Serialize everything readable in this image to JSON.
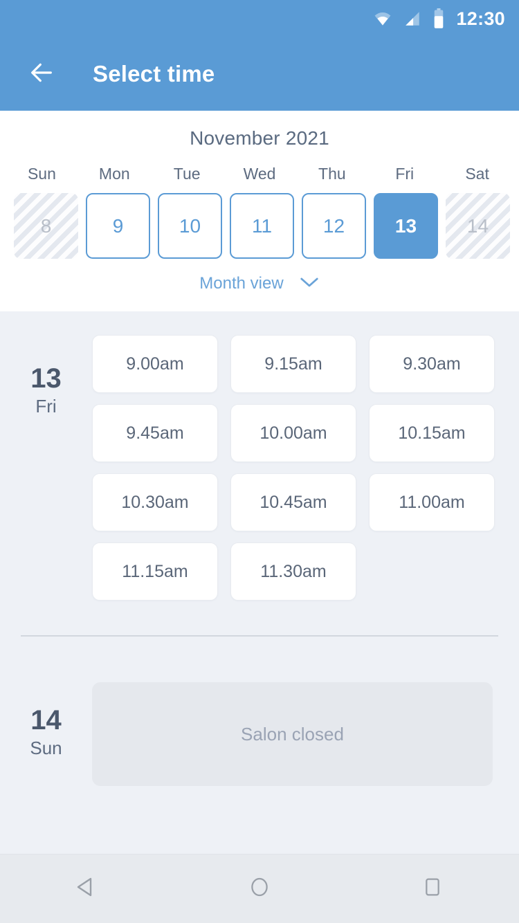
{
  "status_bar": {
    "time": "12:30",
    "icons": [
      "wifi-icon",
      "signal-icon",
      "battery-icon"
    ]
  },
  "app_bar": {
    "back_icon": "arrow-left-icon",
    "title": "Select time"
  },
  "calendar": {
    "month_title": "November 2021",
    "weekdays": [
      "Sun",
      "Mon",
      "Tue",
      "Wed",
      "Thu",
      "Fri",
      "Sat"
    ],
    "days": [
      {
        "num": "8",
        "state": "disabled"
      },
      {
        "num": "9",
        "state": "enabled"
      },
      {
        "num": "10",
        "state": "enabled"
      },
      {
        "num": "11",
        "state": "enabled"
      },
      {
        "num": "12",
        "state": "enabled"
      },
      {
        "num": "13",
        "state": "selected"
      },
      {
        "num": "14",
        "state": "disabled"
      }
    ],
    "month_view_label": "Month view",
    "month_view_icon": "chevron-down-icon"
  },
  "schedule": {
    "days": [
      {
        "date_num": "13",
        "weekday": "Fri",
        "slots": [
          "9.00am",
          "9.15am",
          "9.30am",
          "9.45am",
          "10.00am",
          "10.15am",
          "10.30am",
          "10.45am",
          "11.00am",
          "11.15am",
          "11.30am"
        ],
        "closed_message": null
      },
      {
        "date_num": "14",
        "weekday": "Sun",
        "slots": [],
        "closed_message": "Salon closed"
      }
    ]
  },
  "nav_bar": {
    "buttons": [
      "back-triangle-icon",
      "home-circle-icon",
      "recents-square-icon"
    ]
  },
  "colors": {
    "primary": "#5a9bd5",
    "background": "#eef1f6",
    "card": "#ffffff",
    "text_dark": "#4b586c",
    "text_muted": "#9aa3b4",
    "closed_card": "#e5e8ed"
  }
}
